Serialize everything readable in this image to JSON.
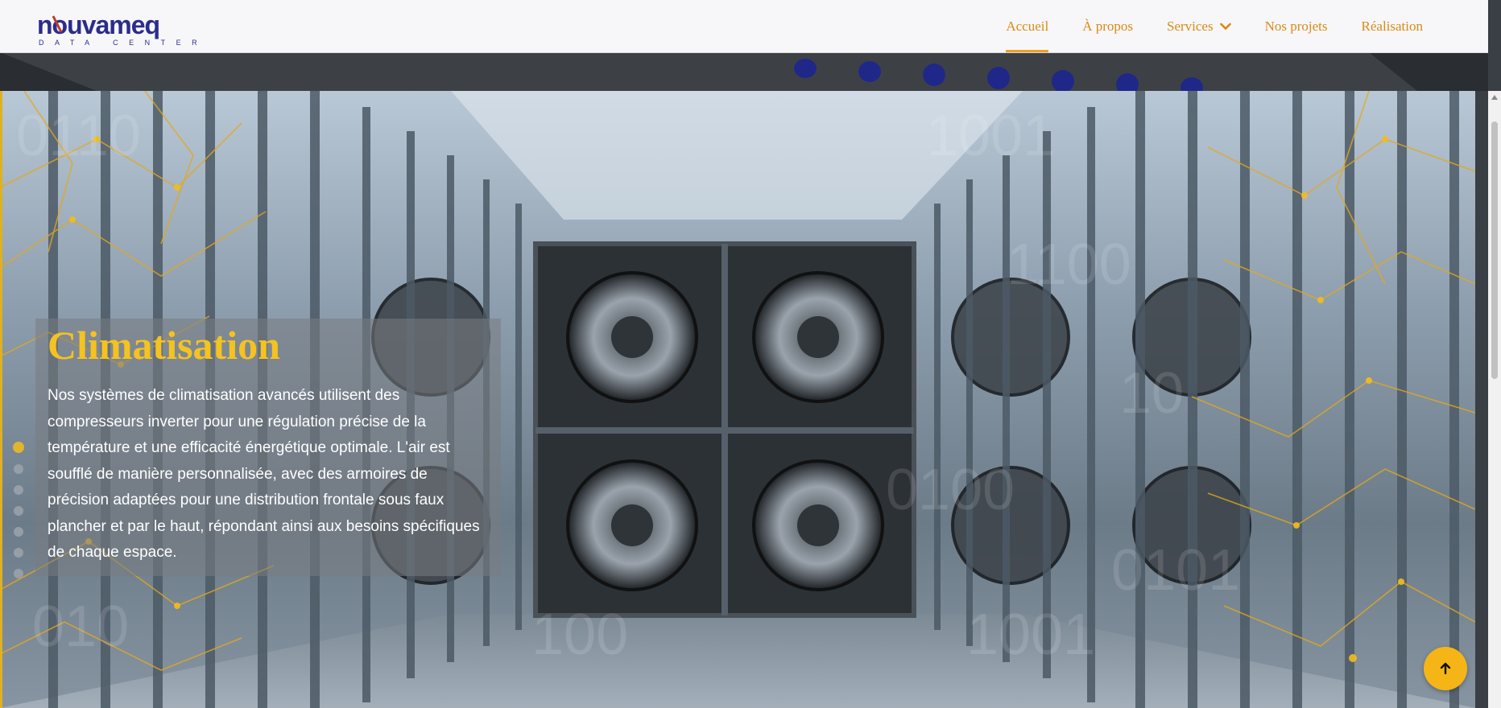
{
  "brand": {
    "name": "nouvameq",
    "tagline": "DATA CENTER",
    "primary_color": "#2b2d8c",
    "accent_color": "#c0392b"
  },
  "nav": {
    "items": [
      {
        "label": "Accueil",
        "active": true
      },
      {
        "label": "À propos",
        "active": false
      },
      {
        "label": "Services",
        "active": false,
        "has_dropdown": true
      },
      {
        "label": "Nos projets",
        "active": false
      },
      {
        "label": "Réalisation",
        "active": false
      }
    ],
    "color": "#d98a14"
  },
  "hero": {
    "title": "Climatisation",
    "description": "Nos systèmes de climatisation avancés utilisent des compresseurs inverter pour une régulation précise de la température et une efficacité énergétique optimale. L'air est soufflé de manière personnalisée, avec des armoires de précision adaptées pour une distribution frontale sous faux plancher et par le haut, répondant ainsi aux besoins spécifiques de chaque espace.",
    "title_color": "#f4c320",
    "slides_total": 7,
    "active_slide": 1
  },
  "scroll_top_button": {
    "icon": "arrow-up-icon",
    "color": "#f5b516"
  }
}
